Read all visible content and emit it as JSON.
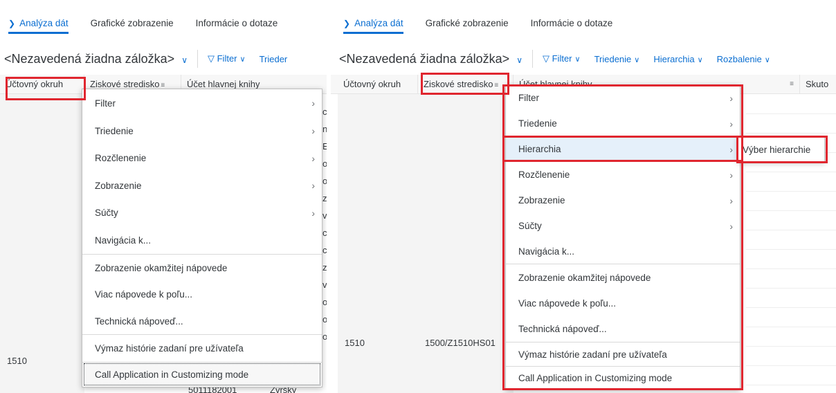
{
  "tabs": [
    "Analýza dát",
    "Grafické zobrazenie",
    "Informácie o dotaze"
  ],
  "view_label": "<Nezavedená žiadna záložka>",
  "toolbar": {
    "filter": "Filter",
    "sort": "Triedenie",
    "sort_cut": "Trieder",
    "hierarchy": "Hierarchia",
    "expand": "Rozbalenie"
  },
  "columns": {
    "company_code": "Účtovný okruh",
    "profit_center": "Ziskové stredisko",
    "gl_account": "Účet hlavnej knihy",
    "actual_cut": "Skuto"
  },
  "left_rows": {
    "company_code": "1510",
    "gl_bottom": "5011182001",
    "gl_desc_bottom": "Zvršky"
  },
  "right_rows": {
    "company_code": "1510",
    "profit_center": "1500/Z1510HS01"
  },
  "left_partial_chars": [
    "c",
    "n",
    "E",
    "o",
    "o",
    "z",
    "v",
    "c",
    "c",
    "z",
    "v",
    "o",
    "o",
    "o"
  ],
  "context_menu": {
    "items": [
      {
        "label": "Filter",
        "submenu": true
      },
      {
        "label": "Triedenie",
        "submenu": true
      },
      {
        "label": "Rozčlenenie",
        "submenu": true
      },
      {
        "label": "Zobrazenie",
        "submenu": true
      },
      {
        "label": "Súčty",
        "submenu": true
      },
      {
        "label": "Navigácia k...",
        "submenu": false
      },
      {
        "label": "Zobrazenie okamžitej nápovede",
        "submenu": false
      },
      {
        "label": "Viac nápovede k poľu...",
        "submenu": false
      },
      {
        "label": "Technická nápoveď...",
        "submenu": false
      },
      {
        "label": "Výmaz histórie zadaní pre užívateľa",
        "submenu": false
      },
      {
        "label": "Call Application in Customizing mode",
        "submenu": false
      }
    ]
  },
  "right_menu_hierarchy": "Hierarchia",
  "hierarchy_submenu": {
    "item": "Výber hierarchie"
  },
  "icons": {
    "submenu_arrow": "chevron-right-icon",
    "tab_chevron": "chevron-down-icon",
    "dropdown": "chevron-down-icon",
    "filter": "funnel-icon",
    "sort_indicator": "sort-icon"
  },
  "colors": {
    "accent": "#0a6ed1",
    "highlight_box": "#e0262f",
    "menu_hover": "#e5f0fa"
  }
}
